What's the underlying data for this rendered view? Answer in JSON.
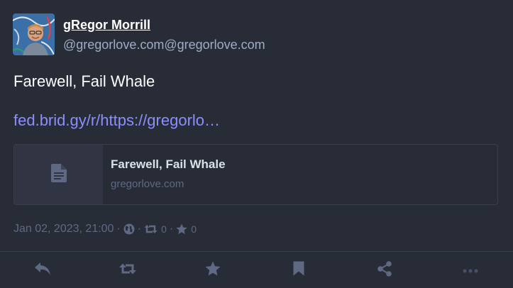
{
  "author": {
    "display_name": "gRegor Morrill",
    "handle": "@gregorlove.com@gregorlove.com"
  },
  "post": {
    "text": "Farewell, Fail Whale",
    "link_text": "fed.brid.gy/r/https://gregorlo…"
  },
  "card": {
    "title": "Farewell, Fail Whale",
    "domain": "gregorlove.com",
    "icon": "document-icon"
  },
  "meta": {
    "timestamp": "Jan 02, 2023, 21:00",
    "separator": "·",
    "visibility_icon": "globe-icon",
    "boost_count": "0",
    "favourite_count": "0"
  },
  "actions": [
    {
      "name": "reply",
      "icon": "reply-icon"
    },
    {
      "name": "boost",
      "icon": "boost-icon"
    },
    {
      "name": "favourite",
      "icon": "star-icon"
    },
    {
      "name": "bookmark",
      "icon": "bookmark-icon"
    },
    {
      "name": "share",
      "icon": "share-icon"
    },
    {
      "name": "more",
      "icon": "more-icon"
    }
  ],
  "colors": {
    "background": "#282c37",
    "link": "#8c8dff",
    "muted": "#606984",
    "secondary": "#9baec8"
  }
}
